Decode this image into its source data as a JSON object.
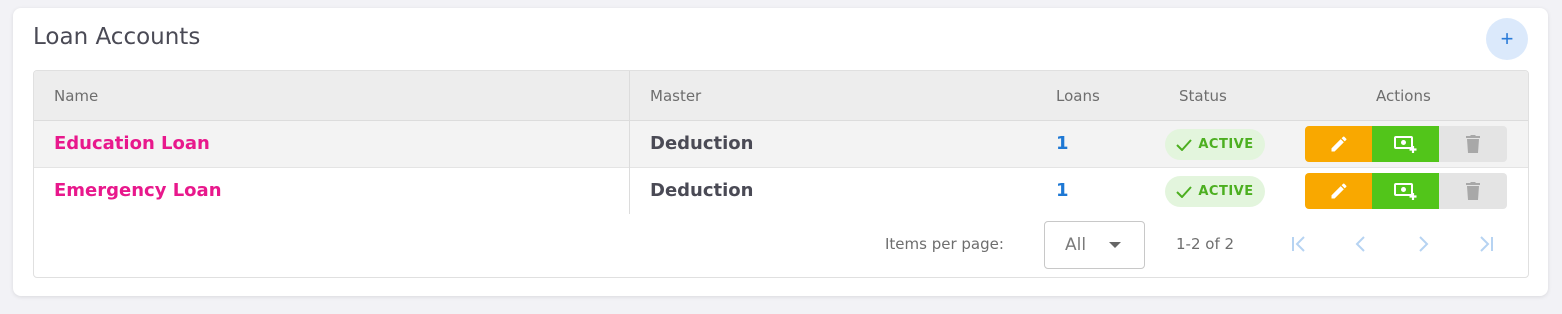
{
  "card": {
    "title": "Loan Accounts",
    "add_label": "+"
  },
  "table": {
    "columns": [
      "Name",
      "Master",
      "Loans",
      "Status",
      "Actions"
    ],
    "rows": [
      {
        "name": "Education Loan",
        "master": "Deduction",
        "loans": "1",
        "status": "ACTIVE"
      },
      {
        "name": "Emergency Loan",
        "master": "Deduction",
        "loans": "1",
        "status": "ACTIVE"
      }
    ]
  },
  "pagination": {
    "items_per_page_label": "Items per page:",
    "items_per_page_value": "All",
    "range_text": "1-2 of 2"
  },
  "icons": {
    "add": "plus-icon",
    "check": "check-icon",
    "edit": "pencil-icon",
    "loan": "money-plus-icon",
    "delete": "trash-icon",
    "first": "first-page-icon",
    "prev": "chevron-left-icon",
    "next": "chevron-right-icon",
    "last": "last-page-icon"
  },
  "colors": {
    "name_text": "#e8188c",
    "loans_text": "#1e78d4",
    "status_green": "#4caf20",
    "edit_bg": "#f9a800",
    "loan_bg": "#52c51a",
    "delete_bg": "#e4e4e4",
    "accent_blue": "#2a7bd8"
  }
}
